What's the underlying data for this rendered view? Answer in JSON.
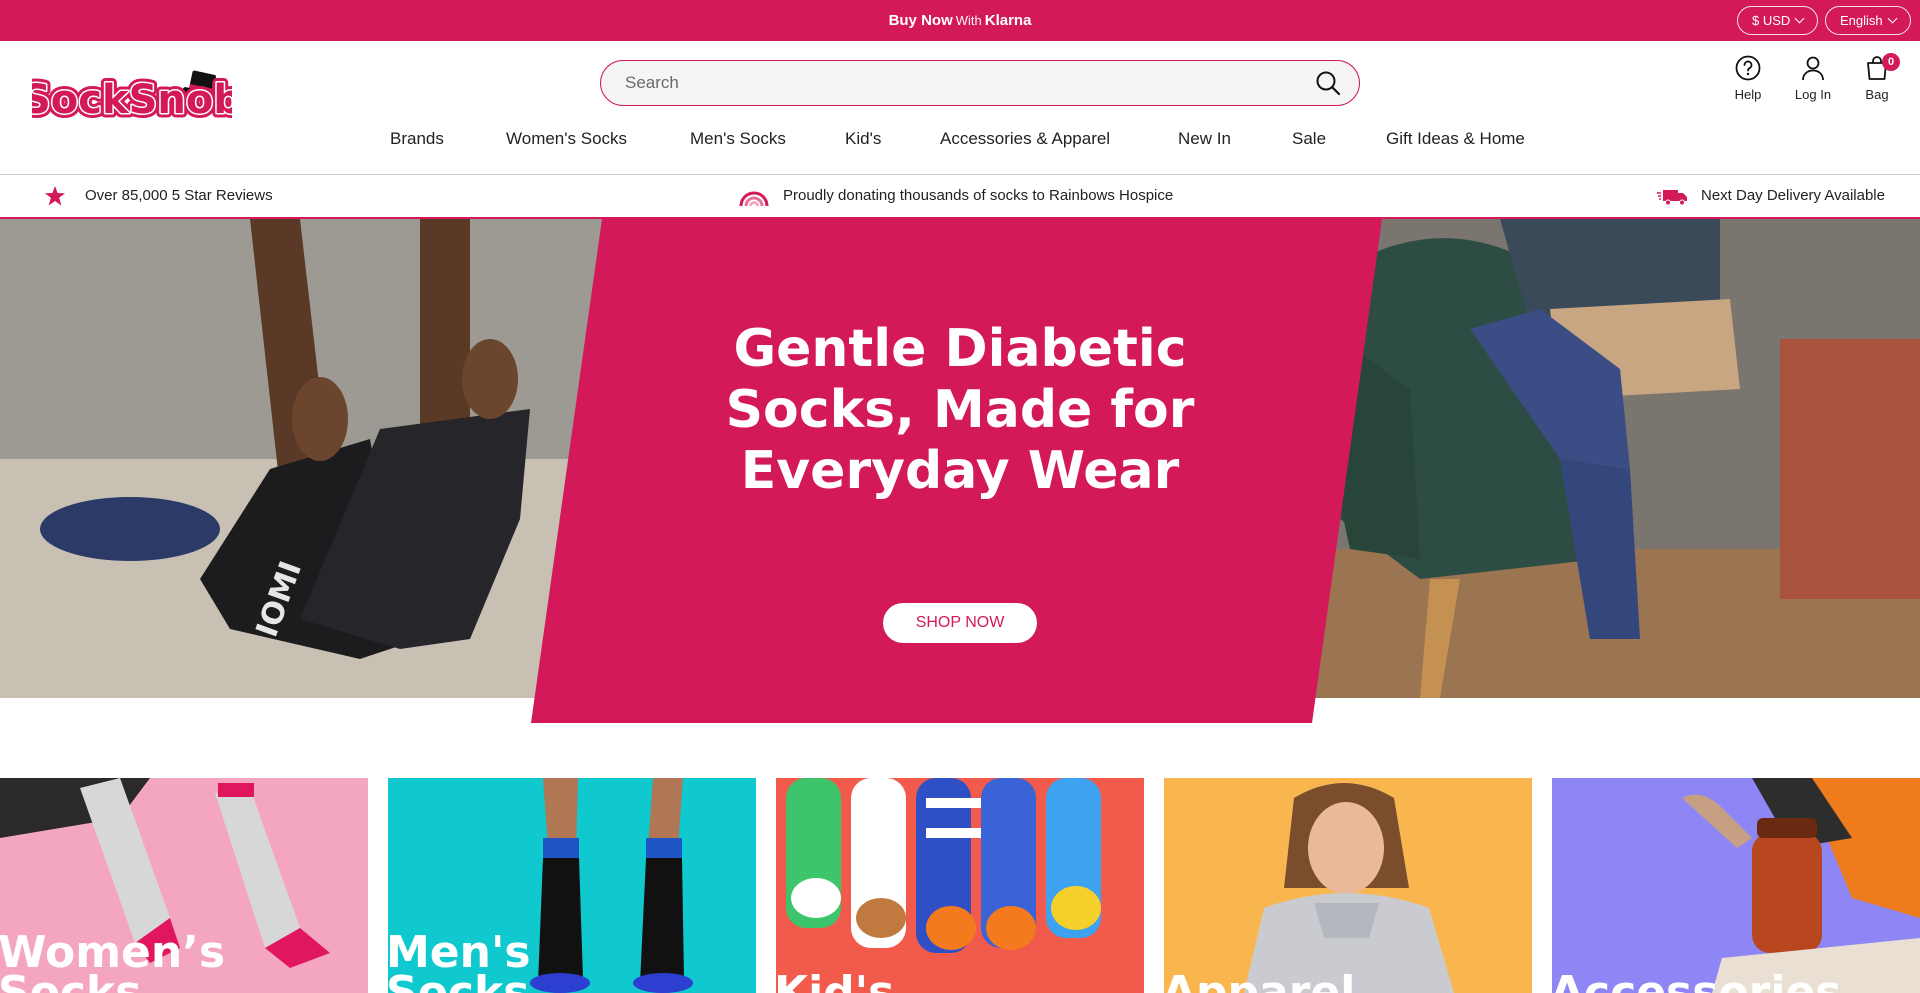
{
  "promo": {
    "buy_now": "Buy Now",
    "with": "With",
    "klarna": "Klarna",
    "currency": "$ USD",
    "language": "English"
  },
  "brand": {
    "logo_text": "SockSnob"
  },
  "search": {
    "placeholder": "Search"
  },
  "header_icons": {
    "help": "Help",
    "login": "Log In",
    "bag": "Bag",
    "bag_count": "0"
  },
  "nav": {
    "items": [
      "Brands",
      "Women's Socks",
      "Men's Socks",
      "Kid's",
      "Accessories & Apparel",
      "New In",
      "Sale",
      "Gift Ideas & Home"
    ]
  },
  "usp": {
    "reviews": "Over 85,000 5 Star Reviews",
    "donating": "Proudly donating thousands of socks to Rainbows Hospice",
    "delivery": "Next Day Delivery Available"
  },
  "hero": {
    "title": "Gentle Diabetic Socks, Made for Everyday Wear",
    "cta": "SHOP NOW",
    "left_sock_print": "IOMI"
  },
  "categories": [
    {
      "label": "Women’s\nSocks",
      "color": "#f4a6c0"
    },
    {
      "label": "Men's\nSocks",
      "color": "#10c9cf"
    },
    {
      "label": "Kid's",
      "color": "#f25b4c"
    },
    {
      "label": "Apparel",
      "color": "#f9b64f"
    },
    {
      "label": "Accessories",
      "color": "#8f86f6"
    }
  ],
  "colors": {
    "brand_pink": "#d4195a",
    "white": "#ffffff"
  }
}
